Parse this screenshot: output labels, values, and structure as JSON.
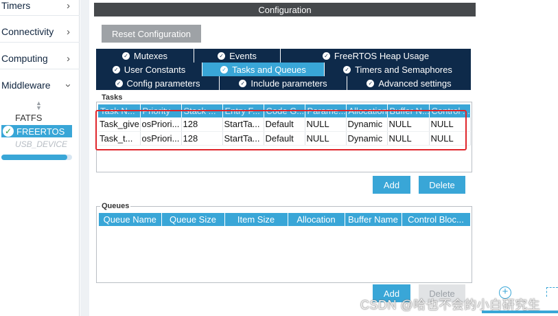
{
  "sidebar": {
    "categories": [
      {
        "label": "Timers"
      },
      {
        "label": "Connectivity"
      },
      {
        "label": "Computing"
      },
      {
        "label": "Middleware"
      }
    ],
    "middleware_items": {
      "fatfs": "FATFS",
      "freertos": "FREERTOS",
      "usb_device": "USB_DEVICE"
    }
  },
  "config": {
    "title": "Configuration",
    "reset_label": "Reset Configuration",
    "tabs_row1": [
      "Mutexes",
      "Events",
      "FreeRTOS Heap Usage"
    ],
    "tabs_row2": [
      "User Constants",
      "Tasks and Queues",
      "Timers and Semaphores"
    ],
    "tabs_row3": [
      "Config parameters",
      "Include parameters",
      "Advanced settings"
    ],
    "active_tab": "Tasks and Queues"
  },
  "tasks": {
    "label": "Tasks",
    "columns": [
      "Task N...",
      "Priority",
      "Stack ...",
      "Entry F...",
      "Code G...",
      "Parame...",
      "Allocation",
      "Buffer N...",
      "Control ..."
    ],
    "rows": [
      [
        "Task_give",
        "osPriori...",
        "128",
        "StartTa...",
        "Default",
        "NULL",
        "Dynamic",
        "NULL",
        "NULL"
      ],
      [
        "Task_t...",
        "osPriori...",
        "128",
        "StartTa...",
        "Default",
        "NULL",
        "Dynamic",
        "NULL",
        "NULL"
      ]
    ],
    "add_label": "Add",
    "delete_label": "Delete"
  },
  "queues": {
    "label": "Queues",
    "columns": [
      "Queue Name",
      "Queue Size",
      "Item Size",
      "Allocation",
      "Buffer Name",
      "Control Bloc..."
    ],
    "add_label": "Add",
    "delete_label": "Delete"
  },
  "watermark": "CSDN @哈也不会的小白研究生",
  "colors": {
    "accent": "#39a6d7",
    "tab_dark": "#0e2a4a",
    "title_bar": "#46494c",
    "highlight": "#e0242a"
  }
}
